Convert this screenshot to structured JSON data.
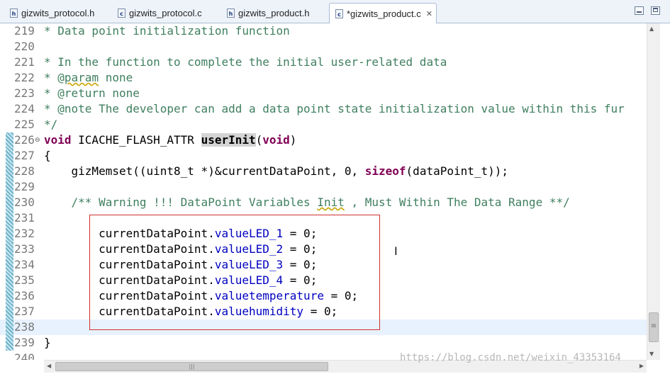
{
  "tabs": [
    {
      "label": "gizwits_protocol.h",
      "icon": "h-file-icon",
      "glyph": "h"
    },
    {
      "label": "gizwits_protocol.c",
      "icon": "c-file-icon",
      "glyph": "c"
    },
    {
      "label": "gizwits_product.h",
      "icon": "h-file-icon",
      "glyph": "h"
    },
    {
      "label": "*gizwits_product.c",
      "icon": "c-file-icon",
      "glyph": "c",
      "close": "✕"
    }
  ],
  "code": {
    "lines": [
      {
        "n": "219",
        "t": "* Data point initialization function"
      },
      {
        "n": "220",
        "t": ""
      },
      {
        "n": "221",
        "t": "* In the function to complete the initial user-related data"
      },
      {
        "n": "222",
        "pre": "* @",
        "warn": "param",
        "post": " none"
      },
      {
        "n": "223",
        "t": "* @return none"
      },
      {
        "n": "224",
        "t": "* @note The developer can add a data point state initialization value within this fur"
      },
      {
        "n": "225",
        "t": "*/"
      },
      {
        "n": "226",
        "kw1": "void",
        "mid": " ICACHE_FLASH_ATTR ",
        "hl": "userInit",
        "open": "(",
        "kw2": "void",
        "close": ")"
      },
      {
        "n": "227",
        "t": "{"
      },
      {
        "n": "228",
        "indent": "    ",
        "pre": "gizMemset((uint8_t *)&currentDataPoint, 0, ",
        "kw": "sizeof",
        "post": "(dataPoint_t));"
      },
      {
        "n": "229",
        "t": ""
      },
      {
        "n": "230",
        "indent": "    ",
        "c1": "/** Warning !!! DataPoint Variables ",
        "warn": "Init",
        "c2": " , Must Within The Data Range **/"
      },
      {
        "n": "231",
        "t": ""
      },
      {
        "n": "232",
        "indent": "        ",
        "obj": "currentDataPoint.",
        "field": "valueLED_1",
        "rest": " = 0;"
      },
      {
        "n": "233",
        "indent": "        ",
        "obj": "currentDataPoint.",
        "field": "valueLED_2",
        "rest": " = 0;"
      },
      {
        "n": "234",
        "indent": "        ",
        "obj": "currentDataPoint.",
        "field": "valueLED_3",
        "rest": " = 0;"
      },
      {
        "n": "235",
        "indent": "        ",
        "obj": "currentDataPoint.",
        "field": "valueLED_4",
        "rest": " = 0;"
      },
      {
        "n": "236",
        "indent": "        ",
        "obj": "currentDataPoint.",
        "field": "valuetemperature",
        "rest": " = 0;"
      },
      {
        "n": "237",
        "indent": "        ",
        "obj": "currentDataPoint.",
        "field": "valuehumidity",
        "rest": " = 0;"
      },
      {
        "n": "238",
        "t": ""
      },
      {
        "n": "239",
        "t": "}"
      },
      {
        "n": "240",
        "t": ""
      }
    ]
  },
  "watermark": "https://blog.csdn.net/weixin_43353164",
  "colors": {
    "comment": "#3f7f5f",
    "keyword": "#7f0055",
    "field": "#0000c0",
    "current_line": "#e8f2fe",
    "highlight_box": "#d03030"
  }
}
